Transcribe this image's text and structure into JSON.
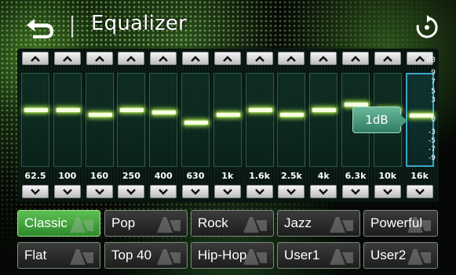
{
  "header": {
    "title": "Equalizer",
    "back_icon": "back-arrow-icon",
    "reset_icon": "reset-icon"
  },
  "eq": {
    "db_unit": "dB",
    "db_scale": [
      "9",
      "7",
      "5",
      "3",
      "0",
      "-3",
      "-5",
      "-7",
      "-9"
    ],
    "bands": [
      {
        "freq": "62.5",
        "gain_db": 2
      },
      {
        "freq": "100",
        "gain_db": 2
      },
      {
        "freq": "160",
        "gain_db": 1
      },
      {
        "freq": "250",
        "gain_db": 2
      },
      {
        "freq": "400",
        "gain_db": 1.5
      },
      {
        "freq": "630",
        "gain_db": -0.5
      },
      {
        "freq": "1k",
        "gain_db": 1
      },
      {
        "freq": "1.6k",
        "gain_db": 2
      },
      {
        "freq": "2.5k",
        "gain_db": 1
      },
      {
        "freq": "4k",
        "gain_db": 2
      },
      {
        "freq": "6.3k",
        "gain_db": 3
      },
      {
        "freq": "10k",
        "gain_db": 2
      },
      {
        "freq": "16k",
        "gain_db": 1
      }
    ],
    "selected_band": 12,
    "gain_readout": "1dB"
  },
  "presets": {
    "row1": [
      "Classic",
      "Pop",
      "Rock",
      "Jazz",
      "Powerful"
    ],
    "row2": [
      "Flat",
      "Top 40",
      "Hip-Hop",
      "User1",
      "User2"
    ],
    "active": "Classic"
  },
  "colors": {
    "accent_green": "#4fae45",
    "knob_glow": "#c8ff60",
    "selected_track": "#3aa6c8"
  }
}
